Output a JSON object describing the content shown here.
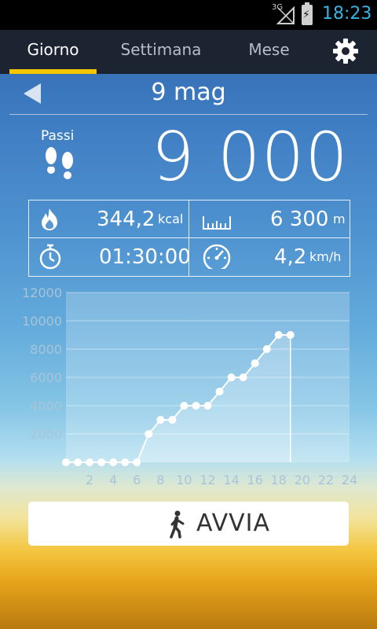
{
  "status_bar": {
    "network": "3G",
    "time": "18:23"
  },
  "tabs": [
    {
      "label": "Giorno",
      "active": true
    },
    {
      "label": "Settimana",
      "active": false
    },
    {
      "label": "Mese",
      "active": false
    }
  ],
  "date": "9 mag",
  "steps": {
    "label": "Passi",
    "value": "9 000"
  },
  "stats": {
    "calories": {
      "value": "344,2",
      "unit": "kcal"
    },
    "distance": {
      "value": "6 300",
      "unit": "m"
    },
    "duration": {
      "value": "01:30:00"
    },
    "speed": {
      "value": "4,2",
      "unit": "km/h"
    }
  },
  "chart_data": {
    "type": "line",
    "x": [
      0,
      1,
      2,
      3,
      4,
      5,
      6,
      7,
      8,
      9,
      10,
      11,
      12,
      13,
      14,
      15,
      16,
      17,
      18,
      19
    ],
    "values": [
      0,
      0,
      0,
      0,
      0,
      0,
      0,
      2000,
      3000,
      3000,
      4000,
      4000,
      4000,
      5000,
      6000,
      6000,
      7000,
      8000,
      9000,
      9000
    ],
    "xticks": [
      "2",
      "4",
      "6",
      "8",
      "10",
      "12",
      "14",
      "16",
      "18",
      "20",
      "22",
      "24"
    ],
    "yticks": [
      "2000",
      "4000",
      "6000",
      "8000",
      "10000",
      "12000"
    ],
    "xlim": [
      0,
      24
    ],
    "ylim": [
      0,
      12000
    ],
    "grid": true
  },
  "colors": {
    "accent": "#f5c500",
    "clock": "#33b5e5"
  },
  "button": {
    "label": "AVVIA"
  }
}
